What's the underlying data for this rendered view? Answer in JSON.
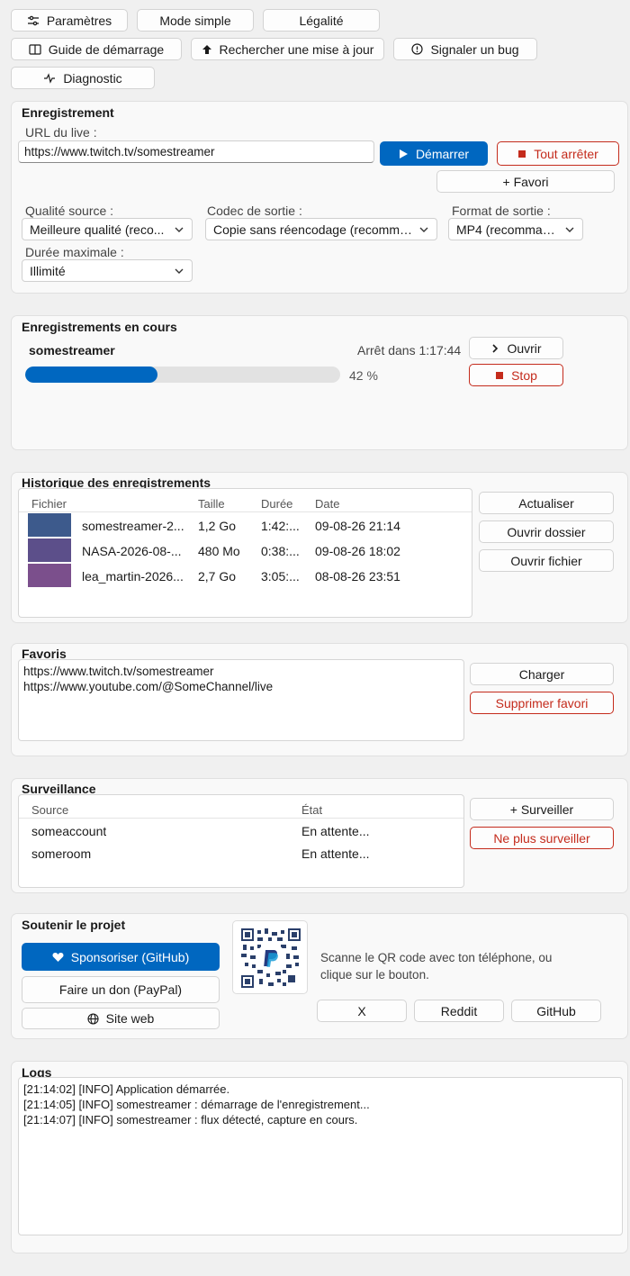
{
  "toolbar": {
    "settings": "Paramètres",
    "simple_mode": "Mode simple",
    "legal": "Légalité",
    "guide": "Guide de démarrage",
    "update": "Rechercher une mise à jour",
    "bug": "Signaler un bug",
    "diagnostic": "Diagnostic"
  },
  "recording": {
    "title": "Enregistrement",
    "url_label": "URL du live :",
    "url_value": "https://www.twitch.tv/somestreamer",
    "start": "Démarrer",
    "stop_all": "Tout arrêter",
    "add_favorite": "+ Favori",
    "quality_label": "Qualité source :",
    "quality_value": "Meilleure qualité (reco...",
    "codec_label": "Codec de sortie :",
    "codec_value": "Copie sans réencodage (recomma...",
    "format_label": "Format de sortie :",
    "format_value": "MP4 (recomman...",
    "duration_label": "Durée maximale :",
    "duration_value": "Illimité"
  },
  "active": {
    "title": "Enregistrements en cours",
    "name": "somestreamer",
    "stop_in": "Arrêt dans 1:17:44",
    "progress": 0.42,
    "progress_text": "42 %",
    "open": "Ouvrir",
    "stop": "Stop"
  },
  "history": {
    "title": "Historique des enregistrements",
    "columns": [
      "Fichier",
      "Taille",
      "Durée",
      "Date"
    ],
    "rows": [
      {
        "file": "somestreamer-2...",
        "size": "1,2 Go",
        "duration": "1:42:...",
        "date": "09-08-26 21:14",
        "thumb": "#3d5a8c"
      },
      {
        "file": "NASA-2026-08-...",
        "size": "480 Mo",
        "duration": "0:38:...",
        "date": "09-08-26 18:02",
        "thumb": "#5c4f8a"
      },
      {
        "file": "lea_martin-2026...",
        "size": "2,7 Go",
        "duration": "3:05:...",
        "date": "08-08-26 23:51",
        "thumb": "#7b4f8c"
      }
    ],
    "refresh": "Actualiser",
    "open_folder": "Ouvrir dossier",
    "open_file": "Ouvrir fichier"
  },
  "favorites": {
    "title": "Favoris",
    "items": [
      "https://www.twitch.tv/somestreamer",
      "https://www.youtube.com/@SomeChannel/live"
    ],
    "load": "Charger",
    "remove": "Supprimer favori"
  },
  "watch": {
    "title": "Surveillance",
    "columns": [
      "Source",
      "État"
    ],
    "rows": [
      {
        "source": "someaccount",
        "state": "En attente..."
      },
      {
        "source": "someroom",
        "state": "En attente..."
      }
    ],
    "add": "+ Surveiller",
    "remove": "Ne plus surveiller"
  },
  "support": {
    "title": "Soutenir le projet",
    "sponsor": "Sponsoriser (GitHub)",
    "paypal": "Faire un don (PayPal)",
    "website": "Site web",
    "qr_text_1": "Scanne le QR code avec ton téléphone, ou",
    "qr_text_2": "clique sur le bouton.",
    "x": "X",
    "reddit": "Reddit",
    "github": "GitHub"
  },
  "logs": {
    "title": "Logs",
    "lines": [
      "[21:14:02] [INFO] Application démarrée.",
      "[21:14:05] [INFO] somestreamer : démarrage de l'enregistrement...",
      "[21:14:07] [INFO] somestreamer : flux détecté, capture en cours."
    ]
  },
  "colors": {
    "accent": "#0067c0",
    "danger": "#c42b1c",
    "progress": "#0067c0"
  }
}
